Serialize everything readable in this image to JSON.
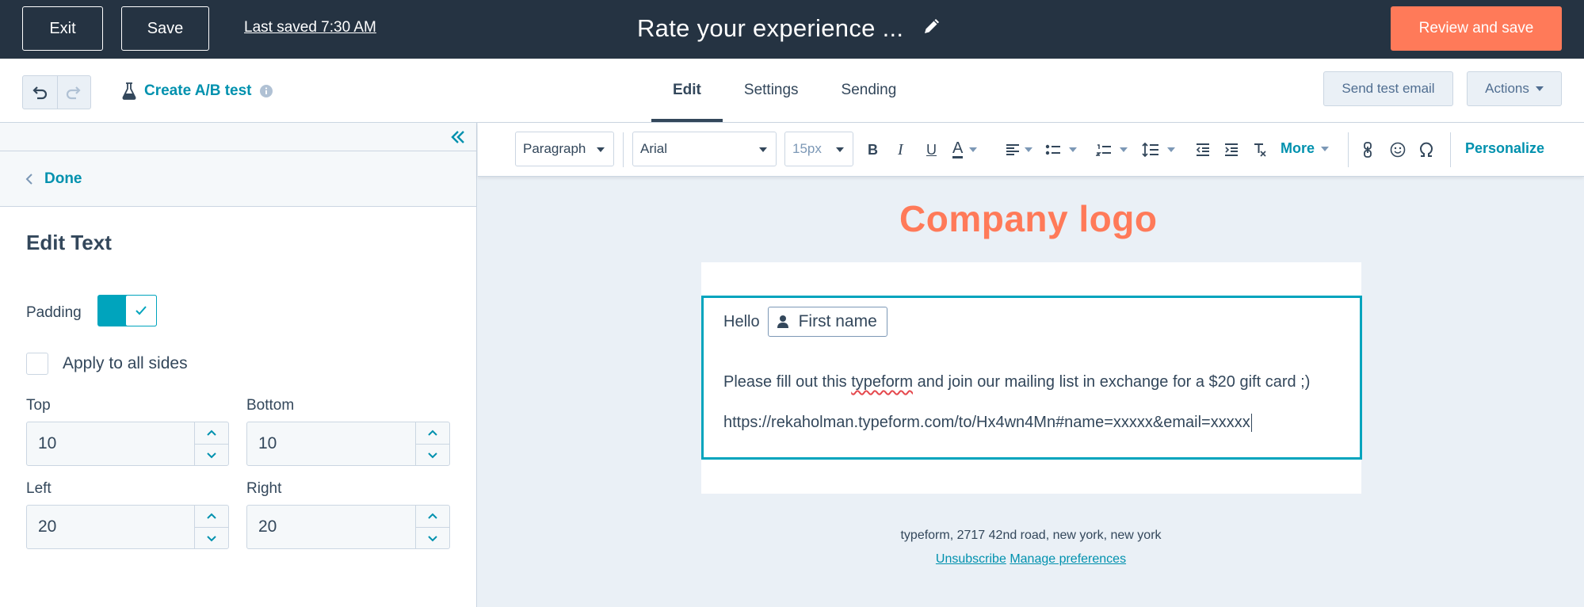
{
  "topbar": {
    "exit_label": "Exit",
    "save_label": "Save",
    "last_saved": "Last saved 7:30 AM",
    "email_title": "Rate your experience ...",
    "review_label": "Review and save",
    "accent_color": "#ff7a59"
  },
  "subbar": {
    "ab_test_label": "Create A/B test",
    "tabs": [
      {
        "label": "Edit",
        "active": true
      },
      {
        "label": "Settings",
        "active": false
      },
      {
        "label": "Sending",
        "active": false
      }
    ],
    "send_test_label": "Send test email",
    "actions_label": "Actions"
  },
  "leftpanel": {
    "done_label": "Done",
    "section_title": "Edit Text",
    "padding_label": "Padding",
    "padding_enabled": true,
    "apply_all_label": "Apply to all sides",
    "apply_all_checked": false,
    "fields": {
      "top": {
        "label": "Top",
        "value": "10"
      },
      "bottom": {
        "label": "Bottom",
        "value": "10"
      },
      "left": {
        "label": "Left",
        "value": "20"
      },
      "right": {
        "label": "Right",
        "value": "20"
      }
    }
  },
  "toolbar": {
    "paragraph": "Paragraph",
    "font": "Arial",
    "size": "15px",
    "more_label": "More",
    "personalize_label": "Personalize"
  },
  "email": {
    "logo_text": "Company logo",
    "greeting": "Hello",
    "token_label": "First name",
    "body_before": "Please fill out this ",
    "body_typo": "typeform",
    "body_after": " and join our mailing list in exchange for a $20 gift card ;)",
    "url": "https://rekaholman.typeform.com/to/Hx4wn4Mn#name=xxxxx&email=xxxxx",
    "footer_address": "typeform, 2717 42nd road, new york, new york",
    "unsubscribe_label": "Unsubscribe",
    "manage_label": "Manage preferences"
  }
}
